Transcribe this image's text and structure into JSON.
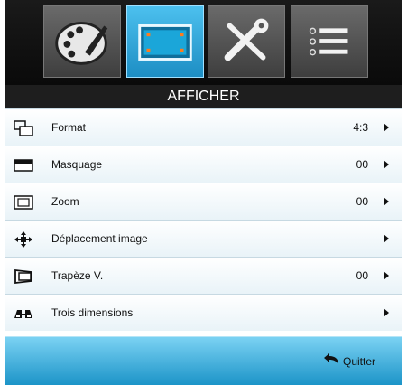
{
  "tabs": [
    {
      "icon": "palette-icon",
      "active": false
    },
    {
      "icon": "display-icon",
      "active": true
    },
    {
      "icon": "tools-icon",
      "active": false
    },
    {
      "icon": "list-icon",
      "active": false
    }
  ],
  "title": "AFFICHER",
  "items": [
    {
      "label": "Format",
      "value": "4:3",
      "icon": "format-icon"
    },
    {
      "label": "Masquage",
      "value": "00",
      "icon": "masking-icon"
    },
    {
      "label": "Zoom",
      "value": "00",
      "icon": "zoom-icon"
    },
    {
      "label": "Déplacement image",
      "value": "",
      "icon": "image-shift-icon"
    },
    {
      "label": "Trapèze V.",
      "value": "00",
      "icon": "keystone-icon"
    },
    {
      "label": "Trois dimensions",
      "value": "",
      "icon": "3d-glasses-icon"
    }
  ],
  "footer": {
    "quit_label": "Quitter",
    "quit_icon": "back-arrow-icon"
  },
  "colors": {
    "accent": "#1d8ec4",
    "tab_bg": "#4a4a4a",
    "title_bg": "#1e1e1e"
  }
}
